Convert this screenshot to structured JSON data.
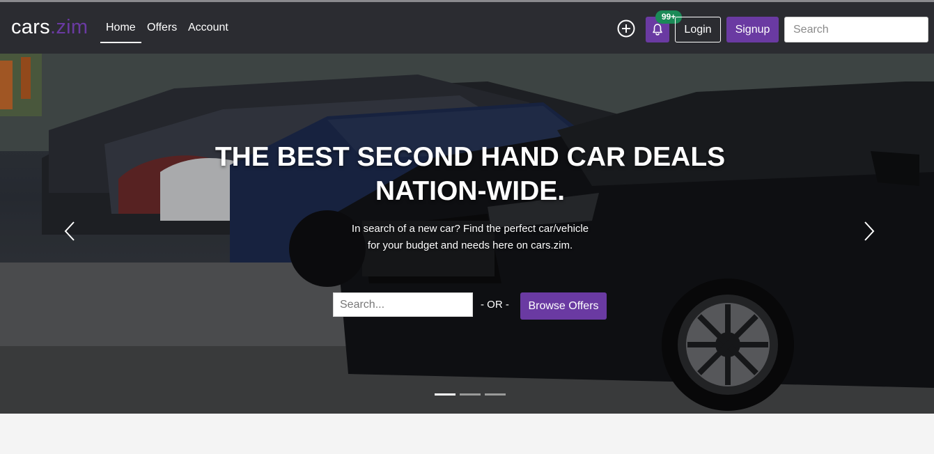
{
  "brand": {
    "part1": "cars",
    "part2": ".zim"
  },
  "nav": {
    "home": "Home",
    "offers": "Offers",
    "account": "Account"
  },
  "actions": {
    "add_icon": "plus-circle-icon",
    "bell_icon": "bell-icon",
    "notifications_badge": "99+",
    "login": "Login",
    "signup": "Signup",
    "search_placeholder": "Search"
  },
  "hero": {
    "title": "THE BEST SECOND HAND CAR DEALS NATION-WIDE.",
    "subtitle": "In search of a new car? Find the perfect car/vehicle for your budget and needs here on cars.zim.",
    "search_placeholder": "Search...",
    "or_text": "- OR -",
    "browse_label": "Browse Offers",
    "carousel": {
      "slides": 3,
      "active": 1
    }
  },
  "colors": {
    "accent": "#6a3aa2",
    "navbar": "#2b2c31",
    "badge": "#1b8a57",
    "page_bg": "#f4f4f4"
  }
}
